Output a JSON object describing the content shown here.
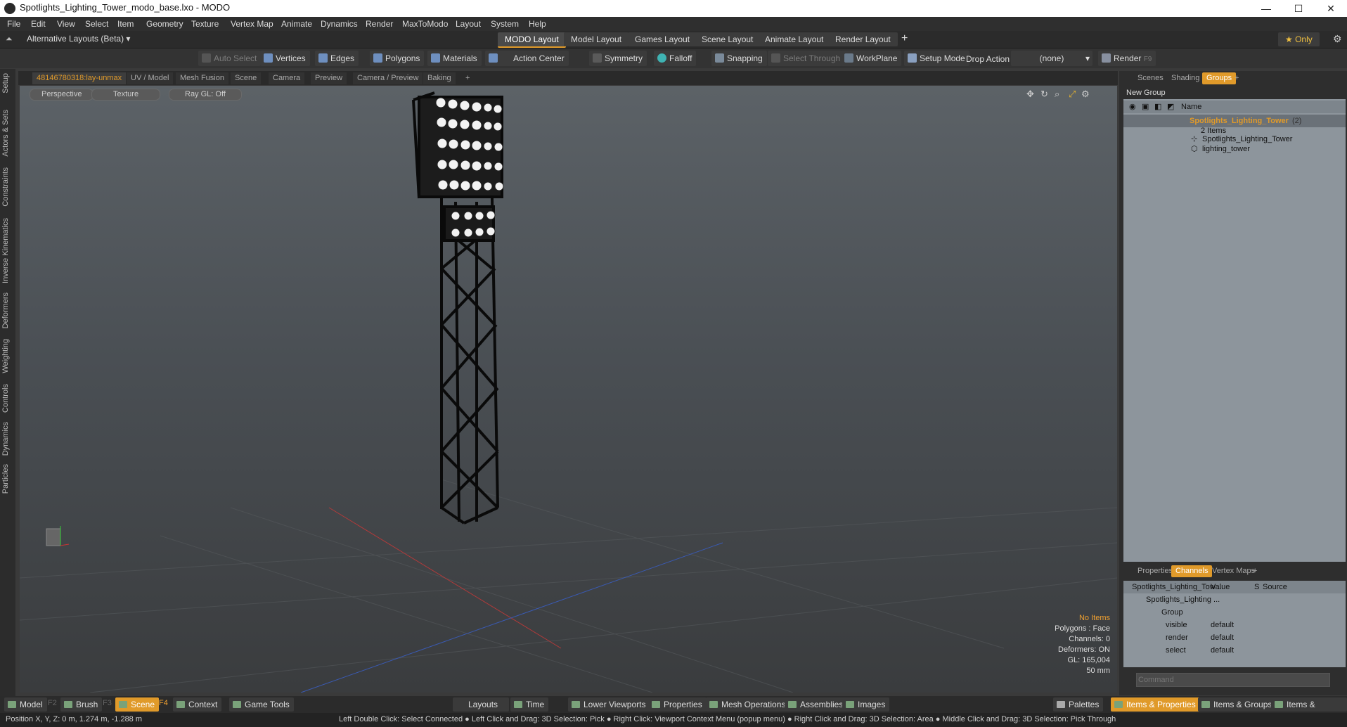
{
  "window": {
    "title": "Spotlights_Lighting_Tower_modo_base.lxo - MODO",
    "minimize": "—",
    "maximize": "☐",
    "close": "✕"
  },
  "menu": [
    "File",
    "Edit",
    "View",
    "Select",
    "Item",
    "Geometry",
    "Texture",
    "Vertex Map",
    "Animate",
    "Dynamics",
    "Render",
    "MaxToModo",
    "Layout",
    "System",
    "Help"
  ],
  "layoutbar": {
    "alt_layouts": "Alternative Layouts (Beta) ▾",
    "tabs": [
      "MODO Layout",
      "Model Layout",
      "Games Layout",
      "Scene Layout",
      "Animate Layout",
      "Render Layout"
    ],
    "add": "+",
    "only": "★ Only"
  },
  "toolbar": {
    "auto_select": "Auto Select",
    "vertices": "Vertices",
    "edges": "Edges",
    "polygons": "Polygons",
    "materials": "Materials",
    "action_center": "Action Center",
    "symmetry": "Symmetry",
    "falloff": "Falloff",
    "snapping": "Snapping",
    "select_through": "Select Through",
    "workplane": "WorkPlane",
    "setup_mode": "Setup Mode",
    "drop_action": "Drop Action",
    "drop_value": "(none)",
    "render": "Render",
    "render_key": "F9"
  },
  "leftstrip": [
    "Setup",
    "Actors & Sets",
    "Constraints",
    "Inverse Kinematics",
    "Deformers",
    "Weighting",
    "Controls",
    "Dynamics",
    "Particles"
  ],
  "viewport_tabs": [
    "48146780318:lay-unmax",
    "UV / Model",
    "Mesh Fusion",
    "Scene",
    "Camera",
    "Preview",
    "Camera / Preview",
    "Baking",
    "+"
  ],
  "viewport": {
    "view": "Perspective",
    "shading": "Texture",
    "raygl": "Ray GL: Off",
    "info": {
      "items": "No Items",
      "polygons": "Polygons : Face",
      "channels": "Channels: 0",
      "deformers": "Deformers: ON",
      "gl": "GL: 165,004",
      "lens": "50 mm"
    }
  },
  "right_tabs": [
    "Scenes",
    "Shading",
    "Groups",
    "+"
  ],
  "groups": {
    "new_group": "New Group",
    "col_name": "Name",
    "root": "Spotlights_Lighting_Tower",
    "root_count": "(2)",
    "items_count": "2 Items",
    "children": [
      "Spotlights_Lighting_Tower",
      "lighting_tower"
    ]
  },
  "prop_tabs": [
    "Properties",
    "Channels",
    "Vertex Maps",
    "+"
  ],
  "channels": {
    "header": [
      "Spotlights_Lighting_Tow ...",
      "Value",
      "S",
      "Source"
    ],
    "root": "Spotlights_Lighting ...",
    "group": "Group",
    "rows": [
      {
        "name": "visible",
        "value": "default"
      },
      {
        "name": "render",
        "value": "default"
      },
      {
        "name": "select",
        "value": "default"
      }
    ],
    "command_placeholder": "Command"
  },
  "bottombar": {
    "left": [
      {
        "label": "Model",
        "key": "F2"
      },
      {
        "label": "Brush",
        "key": "F3"
      },
      {
        "label": "Scene",
        "key": "F4"
      },
      {
        "label": "Context",
        "key": ""
      },
      {
        "label": "Game Tools",
        "key": ""
      }
    ],
    "mid": [
      "Layouts",
      "Time",
      "Lower Viewports",
      "Properties",
      "Mesh Operations",
      "Assemblies",
      "Images"
    ],
    "right": [
      "Palettes",
      "Items & Properties",
      "Items & Groups",
      "Items & Shading"
    ]
  },
  "status": {
    "position": "Position X, Y, Z:   0 m, 1.274 m, -1.288 m",
    "hint": "Left Double Click: Select Connected ● Left Click and Drag: 3D Selection: Pick ● Right Click: Viewport Context Menu (popup menu) ● Right Click and Drag: 3D Selection: Area ● Middle Click and Drag: 3D Selection: Pick Through"
  },
  "colors": {
    "accent": "#e09a2a",
    "panel": "#8d959c"
  }
}
